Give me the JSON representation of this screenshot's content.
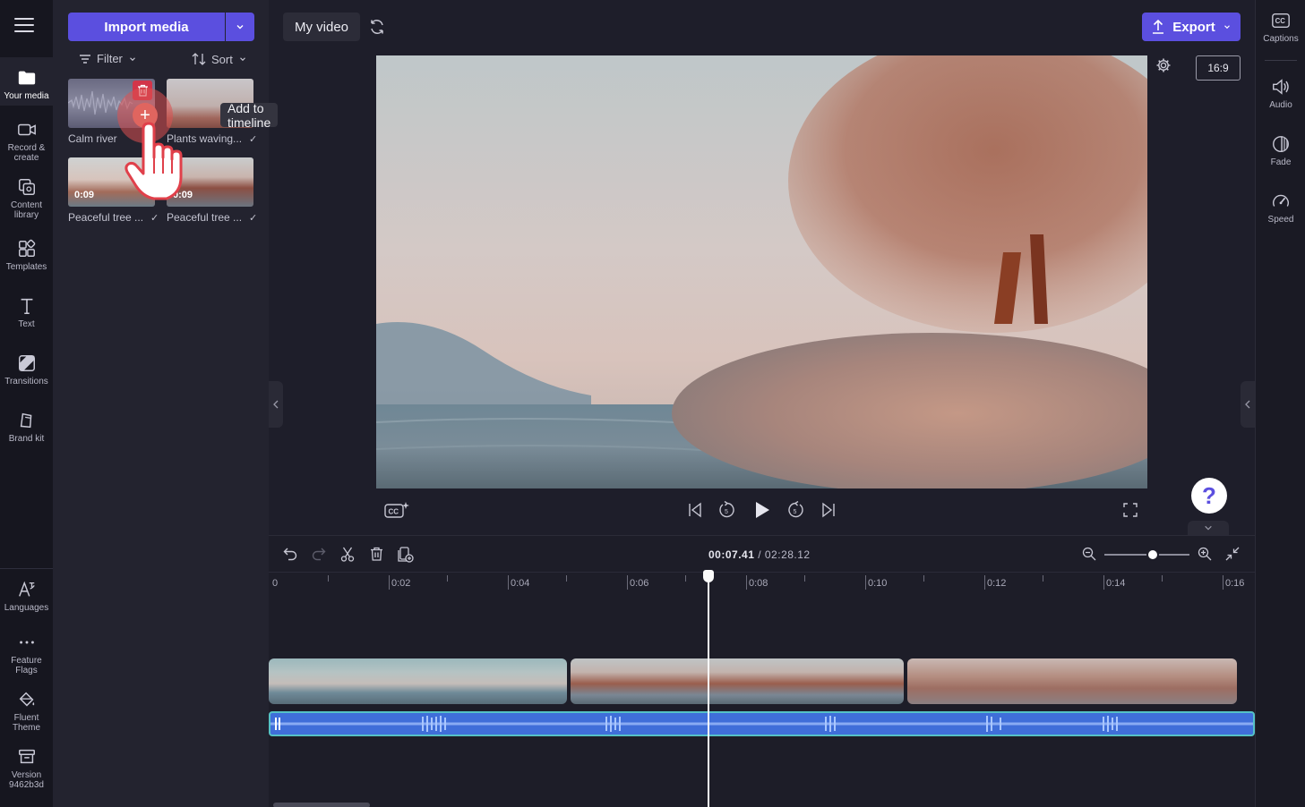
{
  "left_nav": {
    "items": [
      {
        "label": "Your media",
        "icon": "folder-icon"
      },
      {
        "label": "Record &\ncreate",
        "icon": "camera-icon"
      },
      {
        "label": "Content\nlibrary",
        "icon": "library-icon"
      },
      {
        "label": "Templates",
        "icon": "templates-icon"
      },
      {
        "label": "Text",
        "icon": "text-icon"
      },
      {
        "label": "Transitions",
        "icon": "transitions-icon"
      },
      {
        "label": "Brand kit",
        "icon": "brand-kit-icon"
      }
    ],
    "bottom_items": [
      {
        "label": "Languages",
        "icon": "languages-icon"
      },
      {
        "label": "Feature\nFlags",
        "icon": "more-icon"
      },
      {
        "label": "Fluent\nTheme",
        "icon": "paint-bucket-icon"
      },
      {
        "label": "Version\n9462b3d",
        "icon": "archive-icon"
      }
    ]
  },
  "media_panel": {
    "import_label": "Import media",
    "filter_label": "Filter",
    "sort_label": "Sort",
    "items": [
      {
        "label": "Calm river",
        "duration": ""
      },
      {
        "label": "Plants waving...",
        "duration": ""
      },
      {
        "label": "Peaceful tree ...",
        "duration": "0:09"
      },
      {
        "label": "Peaceful tree ...",
        "duration": "0:09"
      }
    ],
    "tooltip": "Add to timeline"
  },
  "top_bar": {
    "project_title": "My video",
    "export_label": "Export",
    "aspect_ratio": "16:9"
  },
  "right_nav": {
    "items": [
      {
        "label": "Captions",
        "icon": "captions-icon"
      },
      {
        "label": "Audio",
        "icon": "speaker-icon"
      },
      {
        "label": "Fade",
        "icon": "fade-icon"
      },
      {
        "label": "Speed",
        "icon": "speedometer-icon"
      }
    ]
  },
  "timeline": {
    "current_time": "00:07.41",
    "total_time": "/ 02:28.12",
    "ruler": [
      "0",
      "0:02",
      "0:04",
      "0:06",
      "0:08",
      "0:10",
      "0:12",
      "0:14",
      "0:16"
    ]
  },
  "help": {
    "label": "?"
  },
  "colors": {
    "accent": "#5b4fdf",
    "audio_track": "#3f6ed9",
    "audio_border": "#55c1c6"
  }
}
